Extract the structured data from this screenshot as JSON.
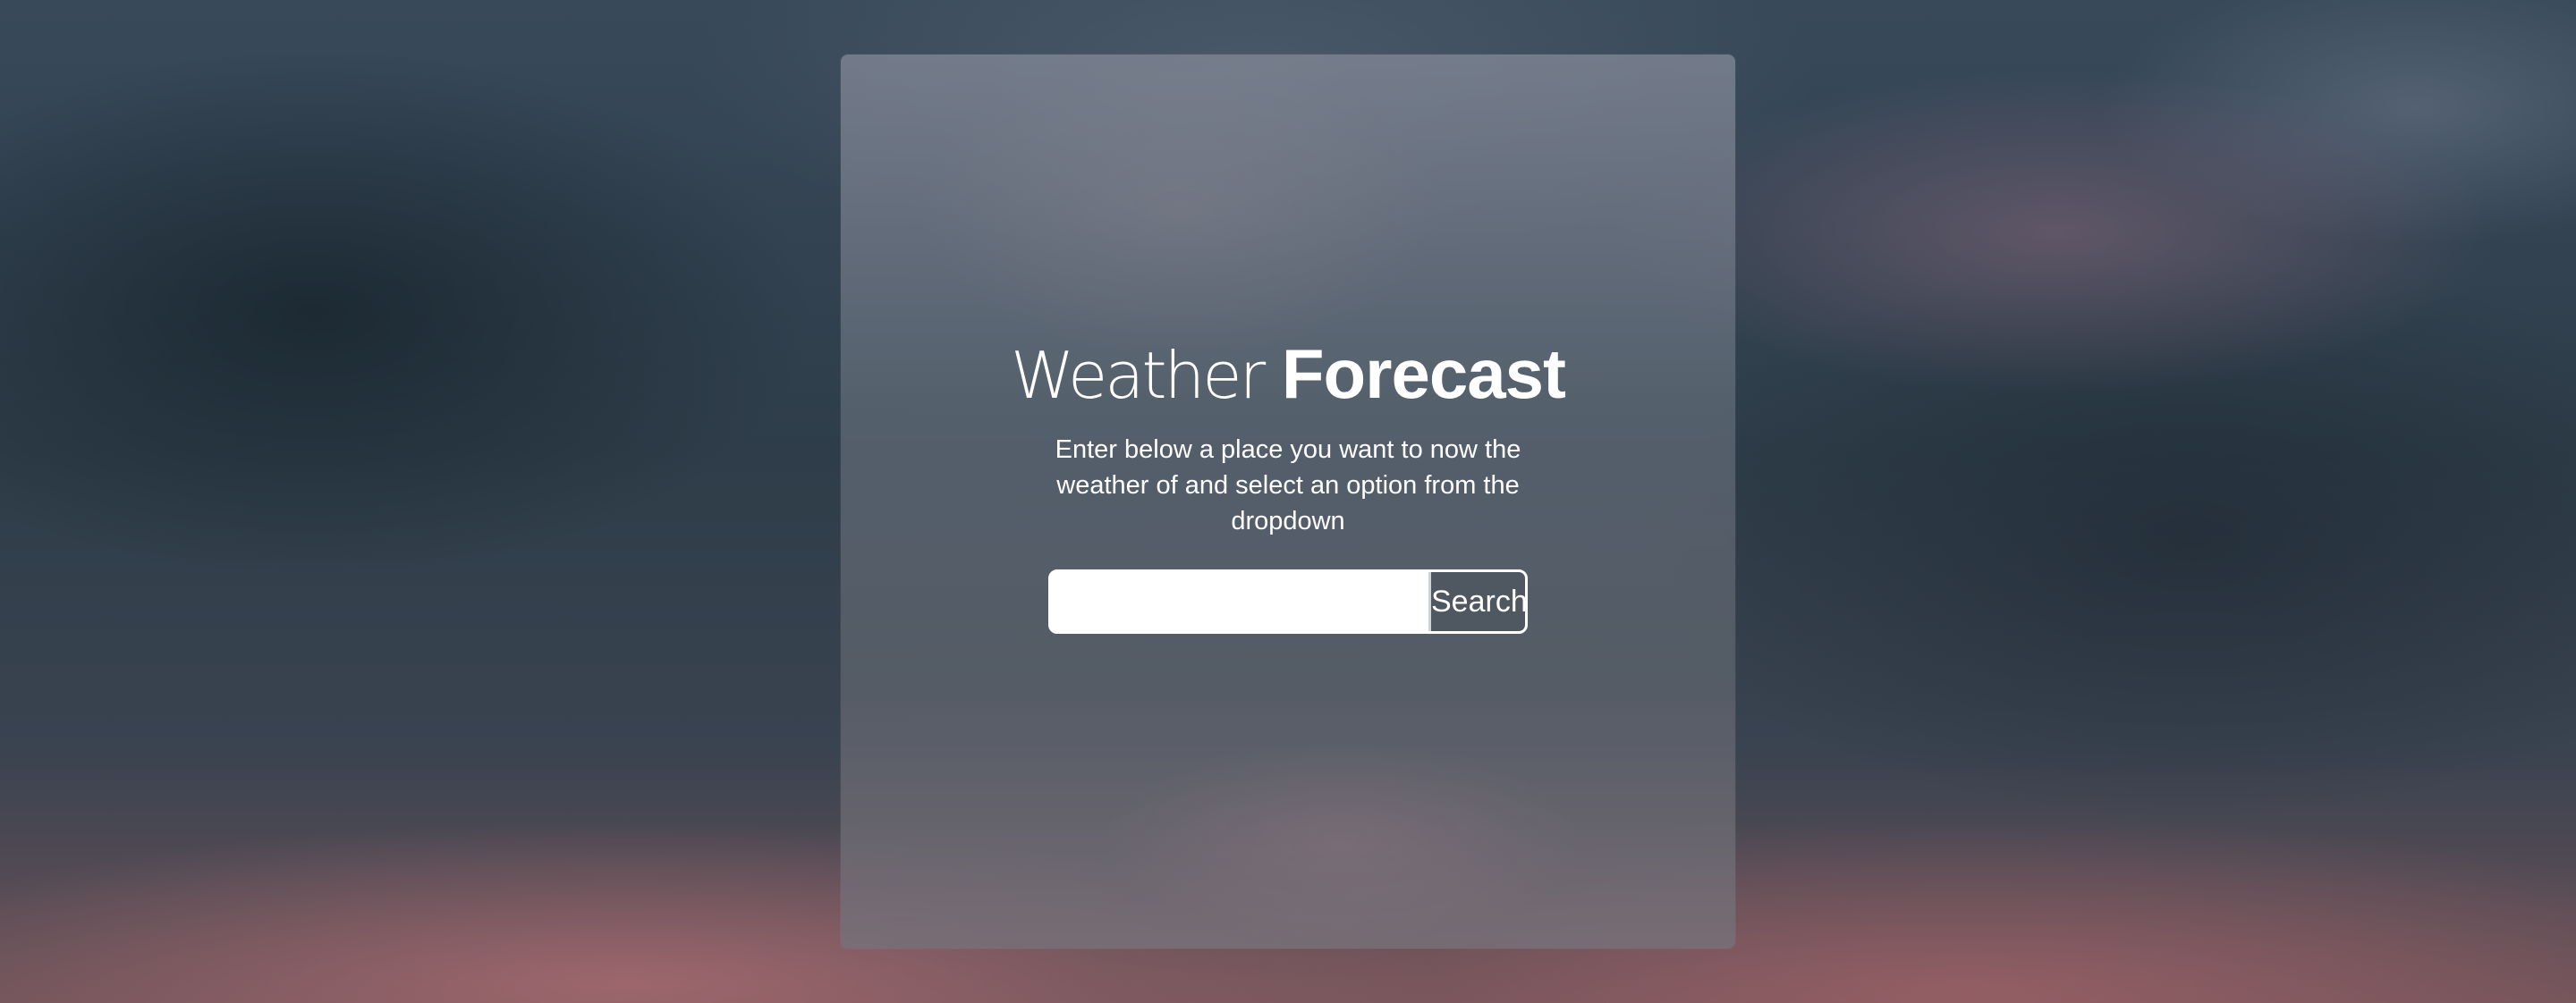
{
  "header": {
    "title_light": "Weather",
    "title_bold": "Forecast",
    "subtitle": "Enter below a place you want to now the weather of and select an option from the dropdown"
  },
  "search": {
    "value": "",
    "placeholder": "",
    "button_label": "Search"
  },
  "colors": {
    "text": "#ffffff",
    "button_bg": "#4f5760",
    "input_bg": "#ffffff"
  }
}
